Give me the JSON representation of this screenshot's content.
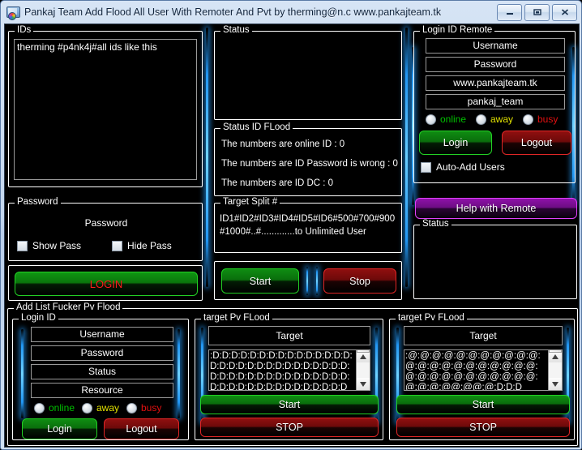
{
  "window": {
    "title": "Pankaj Team Add Flood All User With Remoter And Pvt by therming@n.c www.pankajteam.tk",
    "icon": "app-monitor-icon",
    "minimize_label": "minimize-icon",
    "maximize_label": "maximize-icon",
    "close_label": "close-icon"
  },
  "ids_panel": {
    "legend": "IDs",
    "textarea_value": "therming #p4nk4j#all ids like this"
  },
  "password_panel": {
    "legend": "Password",
    "field_text": "Password",
    "show_pass": "Show Pass",
    "hide_pass": "Hide Pass"
  },
  "login_button": {
    "label": "LOGIN"
  },
  "status_panel": {
    "legend": "Status",
    "text": ""
  },
  "status_id_flood": {
    "legend": "Status ID FLood",
    "lines": [
      "The numbers are online ID : 0",
      "The numbers are ID Password is wrong : 0",
      "The numbers are ID DC : 0"
    ]
  },
  "target_split": {
    "legend": "Target Split #",
    "line1": "ID1#ID2#ID3#ID4#ID5#ID6#500#700#900",
    "line2": "#1000#..#.............to Unlimited User"
  },
  "flood_actions": {
    "start": "Start",
    "stop": "Stop"
  },
  "login_id_remote": {
    "legend": "Login ID Remote",
    "fields": [
      {
        "name": "username",
        "value": "Username"
      },
      {
        "name": "password",
        "value": "Password"
      },
      {
        "name": "site",
        "value": "www.pankajteam.tk"
      },
      {
        "name": "room",
        "value": "pankaj_team"
      }
    ],
    "radios": [
      {
        "label": "online",
        "color": "#00c000"
      },
      {
        "label": "away",
        "color": "#e0e000"
      },
      {
        "label": "busy",
        "color": "#e01010"
      }
    ],
    "login": "Login",
    "logout": "Logout",
    "auto_add": "Auto-Add Users",
    "help_button": "Help with Remote",
    "status_legend": "Status",
    "status_text": ""
  },
  "add_list_panel": {
    "legend": "Add List Fucker Pv Flood",
    "login_id": {
      "legend": "Login ID",
      "fields": [
        {
          "name": "username",
          "value": "Username"
        },
        {
          "name": "password",
          "value": "Password"
        },
        {
          "name": "status",
          "value": "Status"
        },
        {
          "name": "resource",
          "value": "Resource"
        }
      ],
      "radios": [
        {
          "label": "online",
          "color": "#00c000"
        },
        {
          "label": "away",
          "color": "#e0e000"
        },
        {
          "label": "busy",
          "color": "#e01010"
        }
      ],
      "login": "Login",
      "logout": "Logout"
    },
    "pv_flood_left": {
      "legend": "target Pv FLood",
      "target_value": "Target",
      "message_value": ":D:D:D:D:D:D:D:D:D:D:D:D:D:D:D:D:D:D:D:D:D:D:D:D:D:D:D:D:D:D:D:D:D:D:D:D:D:D:D:D:D:D:D:D:D:D:D:D:D:D:D:D:D:D:D:D:D:D:D:D",
      "start": "Start",
      "stop": "STOP"
    },
    "pv_flood_right": {
      "legend": "target Pv FLood",
      "target_value": "Target",
      "message_value": ":@:@:@:@:@:@:@:@:@:@:@:@:@:@:@:@:@:@:@:@:@:@:@:@:@:@:@:@:@:@:@:@:@:@:@:@:@@:@@:@:D:D:D",
      "start": "Start",
      "stop": "STOP"
    }
  },
  "colors": {
    "accent_blue": "#2196f3",
    "green": "#22d024",
    "red": "#e02626",
    "purple": "#e040fb",
    "background": "#000000"
  }
}
